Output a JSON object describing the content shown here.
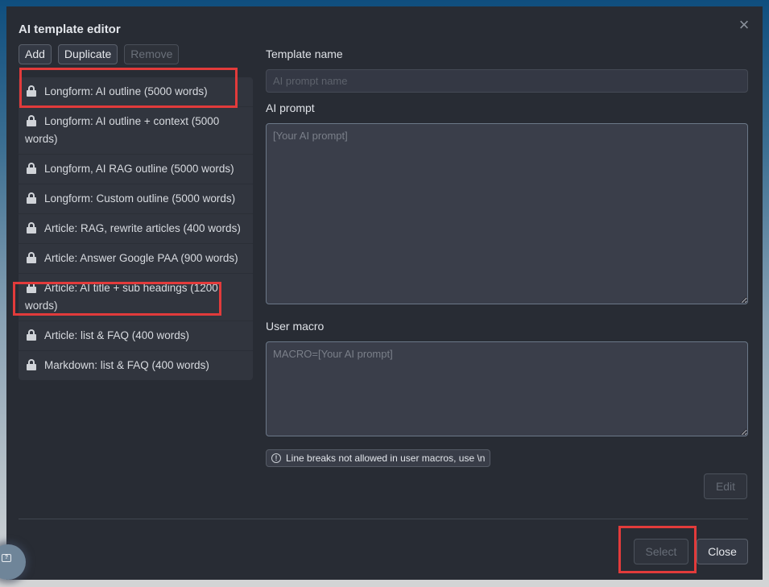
{
  "dialog": {
    "title": "AI template editor",
    "close_icon": "close-icon"
  },
  "toolbar": {
    "add_label": "Add",
    "duplicate_label": "Duplicate",
    "remove_label": "Remove"
  },
  "templates": [
    {
      "label": "Longform: AI outline (5000 words)",
      "icon": "lock-icon",
      "locked": true
    },
    {
      "label": "Longform: AI outline + context (5000 words)",
      "icon": "lock-icon",
      "locked": true
    },
    {
      "label": "Longform, AI RAG outline (5000 words)",
      "icon": "lock-icon",
      "locked": true
    },
    {
      "label": "Longform: Custom outline (5000 words)",
      "icon": "lock-icon",
      "locked": true
    },
    {
      "label": "Article: RAG, rewrite articles (400 words)",
      "icon": "lock-icon",
      "locked": true
    },
    {
      "label": "Article: Answer Google PAA (900 words)",
      "icon": "lock-icon",
      "locked": true
    },
    {
      "label": "Article: AI title + sub headings (1200 words)",
      "icon": "lock-icon",
      "locked": true
    },
    {
      "label": "Article: list & FAQ (400 words)",
      "icon": "lock-icon",
      "locked": true
    },
    {
      "label": "Markdown: list & FAQ (400 words)",
      "icon": "lock-icon",
      "locked": true
    }
  ],
  "form": {
    "template_name_label": "Template name",
    "template_name_value": "",
    "template_name_placeholder": "AI prompt name",
    "ai_prompt_label": "AI prompt",
    "ai_prompt_value": "",
    "ai_prompt_placeholder": "[Your AI prompt]",
    "user_macro_label": "User macro",
    "user_macro_value": "",
    "user_macro_placeholder": "MACRO=[Your AI prompt]",
    "hint_icon": "info-icon",
    "hint_text": "Line breaks not allowed in user macros, use \\n",
    "edit_label": "Edit"
  },
  "footer": {
    "select_label": "Select",
    "close_label": "Close"
  },
  "annotations": {
    "highlight_color": "#e23b3b",
    "highlighted": [
      "Longform: AI outline (5000 words)",
      "Article: list & FAQ (400 words)",
      "Select"
    ]
  },
  "help": {
    "icon": "help-chat-icon"
  }
}
